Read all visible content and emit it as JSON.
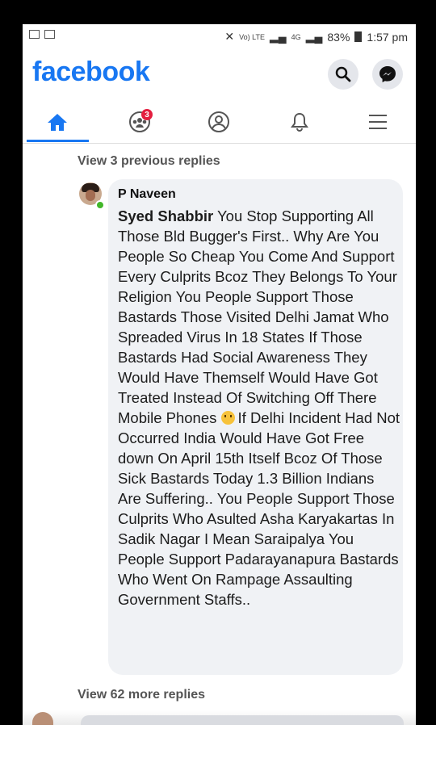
{
  "status_bar": {
    "network": "Vo) LTE",
    "net_4g": "4G",
    "battery": "83%",
    "time": "1:57 pm"
  },
  "header": {
    "logo": "facebook"
  },
  "nav": {
    "groups_badge": "3"
  },
  "comments": {
    "view_previous": "View 3 previous replies",
    "reply": {
      "author": "P Naveen",
      "mention": "Syed Shabbir",
      "text_before_emoji": " You Stop Supporting All Those Bld Bugger's First.. Why Are You People So Cheap You Come And Support Every Culprits Bcoz They Belongs To Your Religion You People Support Those Bastards Those Visited Delhi Jamat Who Spreaded Virus In 18 States If Those Bastards Had Social Awareness They Would Have Themself Would Have Got Treated Instead Of Switching Off There Mobile Phones ",
      "emoji": "worried-face",
      "text_after_emoji": "If Delhi Incident Had Not Occurred India Would Have Got Free down On April 15th Itself Bcoz Of Those Sick Bastards Today 1.3 Billion Indians Are Suffering.. You People Support Those Culprits Who Asulted Asha Karyakartas In Sadik Nagar I Mean Saraipalya You People Support Padarayanapura Bastards Who Went On Rampage Assaulting Government Staffs.."
    },
    "view_more": "View 62 more replies"
  },
  "colors": {
    "brand": "#1877f2",
    "bubble": "#f0f2f5",
    "badge": "#e41e3f"
  }
}
